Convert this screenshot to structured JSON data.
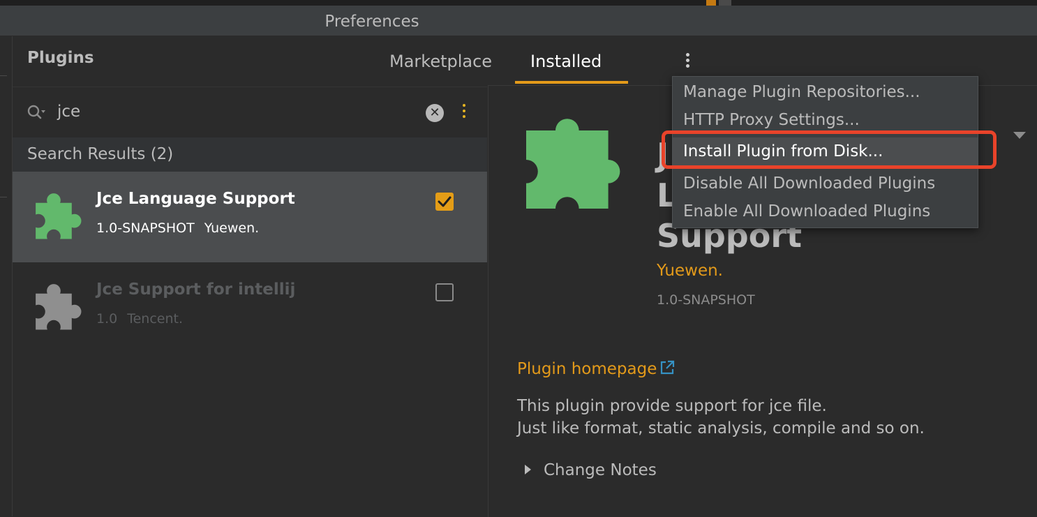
{
  "window": {
    "title": "Preferences"
  },
  "sidebar": {
    "title": "Plugins"
  },
  "tabs": [
    {
      "label": "Marketplace"
    },
    {
      "label": "Installed",
      "active": true
    }
  ],
  "search": {
    "value": "jce"
  },
  "results": {
    "header": "Search Results (2)",
    "items": [
      {
        "name": "Jce Language Support",
        "version": "1.0-SNAPSHOT",
        "vendor": "Yuewen.",
        "enabled": true,
        "selected": true
      },
      {
        "name": "Jce Support for intellij",
        "version": "1.0",
        "vendor": "Tencent.",
        "enabled": false,
        "selected": false
      }
    ]
  },
  "detail": {
    "name_lines": [
      "J",
      "L",
      "Support"
    ],
    "vendor": "Yuewen.",
    "version": "1.0-SNAPSHOT",
    "homepage_label": "Plugin homepage",
    "description_lines": [
      "This plugin provide support for jce file.",
      "Just like format, static analysis, compile and so on."
    ],
    "change_notes_label": "Change Notes"
  },
  "menu": {
    "items": [
      {
        "label": "Manage Plugin Repositories..."
      },
      {
        "label": "HTTP Proxy Settings..."
      },
      {
        "label": "Install Plugin from Disk...",
        "highlighted": true
      },
      {
        "label": "Disable All Downloaded Plugins"
      },
      {
        "label": "Enable All Downloaded Plugins"
      }
    ]
  },
  "colors": {
    "accent": "#e39a1a",
    "plugin_icon_enabled": "#62b96c",
    "plugin_icon_disabled": "#8f8f8f",
    "callout": "#e9432a",
    "link_icon": "#3592c4"
  },
  "icons": [
    "search-icon",
    "clear-icon",
    "kebab-icon",
    "puzzle-icon",
    "external-link-icon",
    "chevron-right-icon",
    "chevron-down-icon",
    "checkbox-icon"
  ]
}
